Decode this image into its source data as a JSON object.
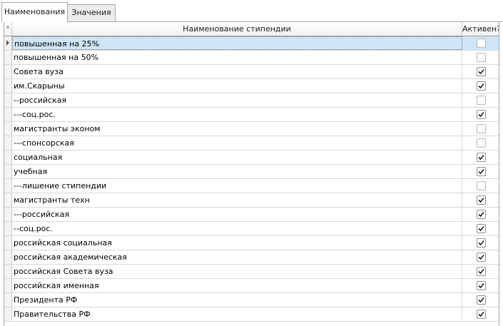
{
  "tabs": [
    {
      "label": "Наименования",
      "active": true
    },
    {
      "label": "Значения",
      "active": false
    }
  ],
  "grid": {
    "selector_header": "*",
    "columns": [
      "Наименование стипендии",
      "Активен?"
    ],
    "current_row": 0,
    "rows": [
      {
        "name": "повышенная на 25%",
        "active": false
      },
      {
        "name": "повышенная на 50%",
        "active": false
      },
      {
        "name": "Совета вуза",
        "active": true
      },
      {
        "name": "им.Скарыны",
        "active": true
      },
      {
        "name": "--российская",
        "active": false
      },
      {
        "name": "---соц.рос.",
        "active": true
      },
      {
        "name": "магистранты эконом",
        "active": false
      },
      {
        "name": "---спонсорская",
        "active": false
      },
      {
        "name": "социальная",
        "active": true
      },
      {
        "name": "учебная",
        "active": true
      },
      {
        "name": "---лишение стипендии",
        "active": false
      },
      {
        "name": "магистранты техн",
        "active": true
      },
      {
        "name": "---российская",
        "active": true
      },
      {
        "name": "--соц.рос.",
        "active": true
      },
      {
        "name": "российская социальная",
        "active": true
      },
      {
        "name": "российская академическая",
        "active": true
      },
      {
        "name": "российская Совета вуза",
        "active": true
      },
      {
        "name": "российская именная",
        "active": true
      },
      {
        "name": "Президента РФ",
        "active": true
      },
      {
        "name": "Правительства РФ",
        "active": true
      }
    ]
  }
}
